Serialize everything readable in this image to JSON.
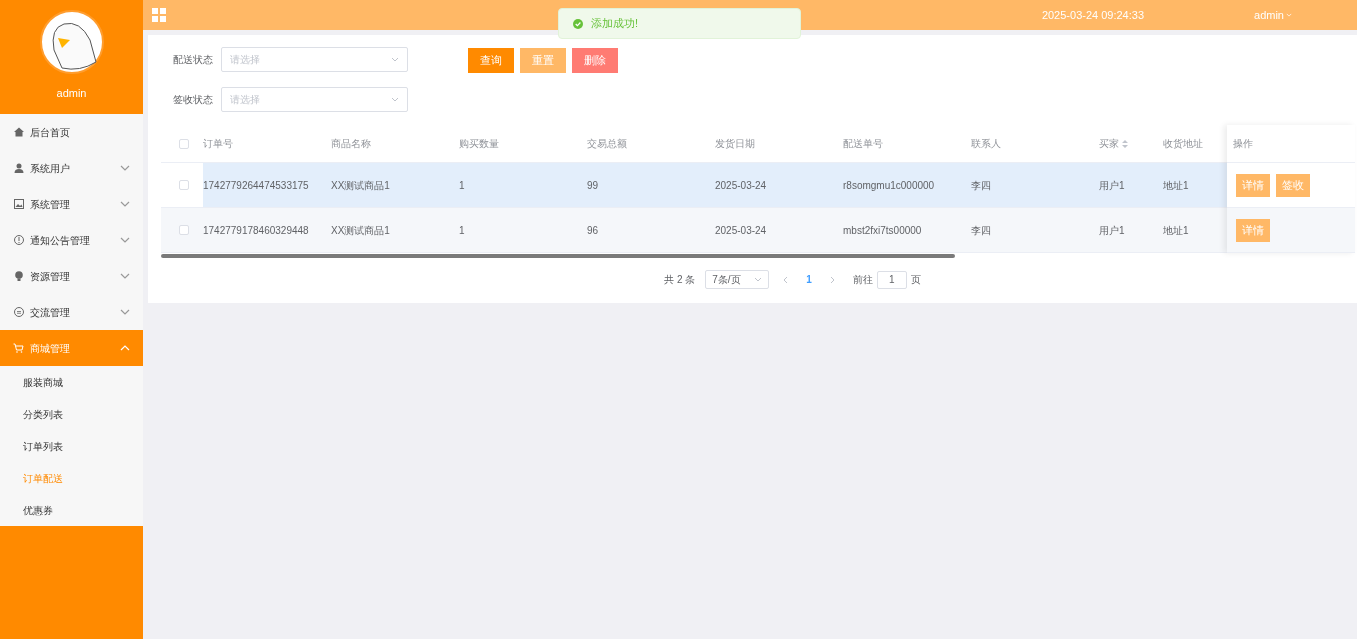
{
  "sidebar": {
    "user": "admin",
    "items": [
      {
        "label": "后台首页",
        "selected": false
      },
      {
        "label": "系统用户",
        "expanded": false,
        "selected": false
      },
      {
        "label": "系统管理",
        "expanded": false,
        "selected": false
      },
      {
        "label": "通知公告管理",
        "expanded": false,
        "selected": false
      },
      {
        "label": "资源管理",
        "expanded": false,
        "selected": false
      },
      {
        "label": "交流管理",
        "expanded": false,
        "selected": false
      },
      {
        "label": "商城管理",
        "expanded": true,
        "selected": true,
        "children": [
          {
            "label": "服装商城",
            "selected": false
          },
          {
            "label": "分类列表",
            "selected": false
          },
          {
            "label": "订单列表",
            "selected": false
          },
          {
            "label": "订单配送",
            "selected": true
          },
          {
            "label": "优惠券",
            "selected": false
          }
        ]
      }
    ]
  },
  "header": {
    "datetime": "2025-03-24 09:24:33",
    "user": "admin"
  },
  "toast": {
    "message": "添加成功!"
  },
  "filters": [
    {
      "label": "配送状态",
      "placeholder": "请选择"
    },
    {
      "label": "签收状态",
      "placeholder": "请选择"
    }
  ],
  "buttons": [
    {
      "label": "查询",
      "kind": "primary"
    },
    {
      "label": "重置",
      "kind": "secondary"
    },
    {
      "label": "删除",
      "kind": "danger"
    }
  ],
  "table": {
    "all_checked": false,
    "columns": [
      {
        "label": "订单号"
      },
      {
        "label": "商品名称"
      },
      {
        "label": "购买数量"
      },
      {
        "label": "交易总额"
      },
      {
        "label": "发货日期"
      },
      {
        "label": "配送单号"
      },
      {
        "label": "联系人"
      },
      {
        "label": "买家",
        "sortable": true
      },
      {
        "label": "收货地址"
      }
    ],
    "actions_column": "操作",
    "rows": [
      {
        "checked": false,
        "hovered": true,
        "cells": [
          "1742779264474533175",
          "XX测试商品1",
          "1",
          "99",
          "2025-03-24",
          "r8somgmu1c000000",
          "李四",
          "用户1",
          "地址1"
        ],
        "actions": [
          "详情",
          "签收"
        ]
      },
      {
        "checked": false,
        "hovered": false,
        "cells": [
          "1742779178460329448",
          "XX测试商品1",
          "1",
          "96",
          "2025-03-24",
          "mbst2fxi7ts00000",
          "李四",
          "用户1",
          "地址1"
        ],
        "actions": [
          "详情"
        ]
      }
    ]
  },
  "pagination": {
    "total": "共 2 条",
    "page_size": "7条/页",
    "pages": [
      {
        "label": "1",
        "selected": true
      }
    ],
    "goto_label": "前往",
    "goto_value": "1",
    "goto_suffix": "页"
  }
}
